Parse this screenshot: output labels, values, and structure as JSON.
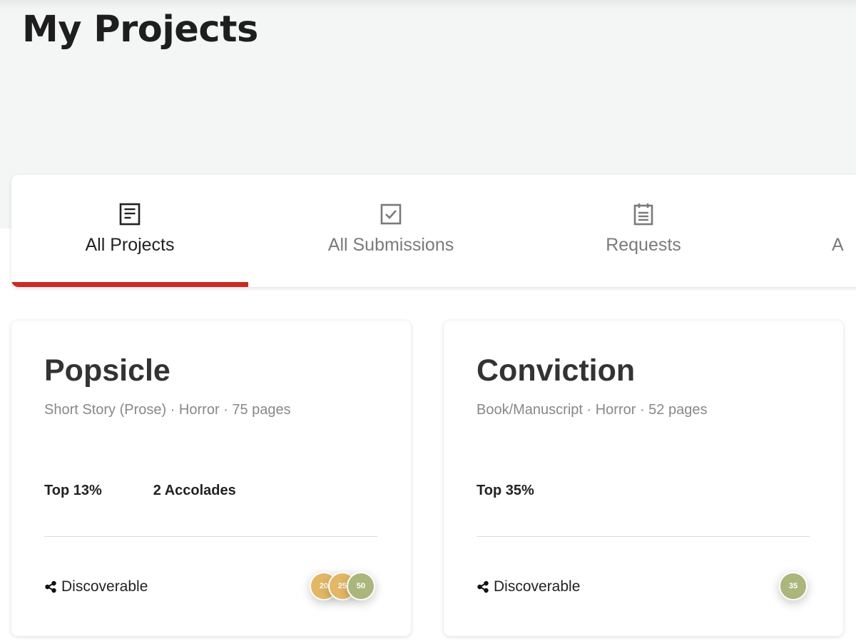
{
  "page": {
    "title": "My Projects"
  },
  "tabs": [
    {
      "label": "All Projects",
      "icon": "document-icon",
      "active": true
    },
    {
      "label": "All Submissions",
      "icon": "checkbox-icon",
      "active": false
    },
    {
      "label": "Requests",
      "icon": "clipboard-icon",
      "active": false
    },
    {
      "label": "A",
      "icon": "",
      "active": false
    }
  ],
  "accent_color": "#cc2a22",
  "projects": [
    {
      "title": "Popsicle",
      "meta": "Short Story (Prose) · Horror · 75 pages",
      "stats": [
        "Top 13%",
        "2 Accolades"
      ],
      "visibility": "Discoverable",
      "badges": [
        {
          "label": "20",
          "color": "#e2b866"
        },
        {
          "label": "25",
          "color": "#e2b866"
        },
        {
          "label": "50",
          "color": "#aab67c"
        }
      ]
    },
    {
      "title": "Conviction",
      "meta": "Book/Manuscript · Horror · 52 pages",
      "stats": [
        "Top 35%"
      ],
      "visibility": "Discoverable",
      "badges": [
        {
          "label": "35",
          "color": "#aab67c"
        }
      ]
    }
  ]
}
